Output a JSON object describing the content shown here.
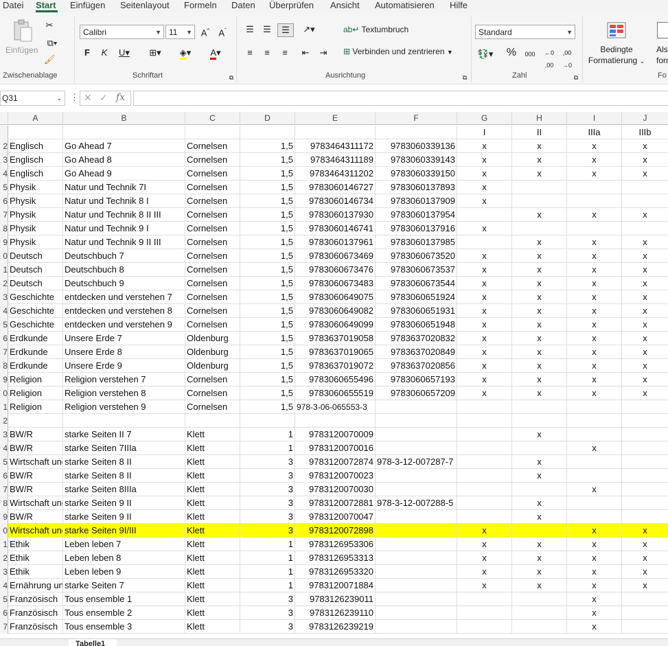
{
  "menu": [
    "Datei",
    "Start",
    "Einfügen",
    "Seitenlayout",
    "Formeln",
    "Daten",
    "Überprüfen",
    "Ansicht",
    "Automatisieren",
    "Hilfe"
  ],
  "ribbon": {
    "paste_label": "Einfügen",
    "clipboard_label": "Zwischenablage",
    "font_name": "Calibri",
    "font_size": "11",
    "font_label": "Schriftart",
    "wrap_label": "Textumbruch",
    "merge_label": "Verbinden und zentrieren",
    "alignment_label": "Ausrichtung",
    "number_format": "Standard",
    "number_label": "Zahl",
    "cond_format_label1": "Bedingte",
    "cond_format_label2": "Formatierung",
    "as_table_label1": "Als",
    "as_table_label2": "form",
    "styles_label": "Fo"
  },
  "formula_bar": {
    "name_box": "Q31",
    "content": ""
  },
  "columns": [
    "A",
    "B",
    "C",
    "D",
    "E",
    "F",
    "G",
    "H",
    "I",
    "J"
  ],
  "header_row": {
    "g": "I",
    "h": "II",
    "i": "IIIa",
    "j": "IIIb"
  },
  "rows": [
    {
      "n": "2",
      "a": "Englisch",
      "b": "Go Ahead 7",
      "c": "Cornelsen",
      "d": "1,5",
      "e": "9783464311172",
      "f": "9783060339136",
      "g": "x",
      "h": "x",
      "i": "x",
      "j": "x"
    },
    {
      "n": "3",
      "a": "Englisch",
      "b": "Go Ahead 8",
      "c": "Cornelsen",
      "d": "1,5",
      "e": "9783464311189",
      "f": "9783060339143",
      "g": "x",
      "h": "x",
      "i": "x",
      "j": "x"
    },
    {
      "n": "4",
      "a": "Englisch",
      "b": "Go Ahead 9",
      "c": "Cornelsen",
      "d": "1,5",
      "e": "9783464311202",
      "f": "9783060339150",
      "g": "x",
      "h": "x",
      "i": "x",
      "j": "x"
    },
    {
      "n": "5",
      "a": "Physik",
      "b": "Natur und Technik 7I",
      "c": "Cornelsen",
      "d": "1,5",
      "e": "9783060146727",
      "f": "9783060137893",
      "g": "x",
      "h": "",
      "i": "",
      "j": ""
    },
    {
      "n": "6",
      "a": "Physik",
      "b": "Natur und Technik 8 I",
      "c": "Cornelsen",
      "d": "1,5",
      "e": "9783060146734",
      "f": "9783060137909",
      "g": "x",
      "h": "",
      "i": "",
      "j": ""
    },
    {
      "n": "7",
      "a": "Physik",
      "b": "Natur und Technik 8 II III",
      "c": "Cornelsen",
      "d": "1,5",
      "e": "9783060137930",
      "f": "9783060137954",
      "g": "",
      "h": "x",
      "i": "x",
      "j": "x"
    },
    {
      "n": "8",
      "a": "Physik",
      "b": "Natur und Technik 9 I",
      "c": "Cornelsen",
      "d": "1,5",
      "e": "9783060146741",
      "f": "9783060137916",
      "g": "x",
      "h": "",
      "i": "",
      "j": ""
    },
    {
      "n": "9",
      "a": "Physik",
      "b": "Natur und Technik 9 II III",
      "c": "Cornelsen",
      "d": "1,5",
      "e": "9783060137961",
      "f": "9783060137985",
      "g": "",
      "h": "x",
      "i": "x",
      "j": "x"
    },
    {
      "n": "0",
      "a": "Deutsch",
      "b": "Deutschbuch 7",
      "c": "Cornelsen",
      "d": "1,5",
      "e": "9783060673469",
      "f": "9783060673520",
      "g": "x",
      "h": "x",
      "i": "x",
      "j": "x"
    },
    {
      "n": "1",
      "a": "Deutsch",
      "b": "Deutschbuch 8",
      "c": "Cornelsen",
      "d": "1,5",
      "e": "9783060673476",
      "f": "9783060673537",
      "g": "x",
      "h": "x",
      "i": "x",
      "j": "x"
    },
    {
      "n": "2",
      "a": "Deutsch",
      "b": "Deutschbuch 9",
      "c": "Cornelsen",
      "d": "1,5",
      "e": "9783060673483",
      "f": "9783060673544",
      "g": "x",
      "h": "x",
      "i": "x",
      "j": "x"
    },
    {
      "n": "3",
      "a": "Geschichte",
      "b": "entdecken und verstehen 7",
      "c": "Cornelsen",
      "d": "1,5",
      "e": "9783060649075",
      "f": "9783060651924",
      "g": "x",
      "h": "x",
      "i": "x",
      "j": "x"
    },
    {
      "n": "4",
      "a": "Geschichte",
      "b": "entdecken und verstehen 8",
      "c": "Cornelsen",
      "d": "1,5",
      "e": "9783060649082",
      "f": "9783060651931",
      "g": "x",
      "h": "x",
      "i": "x",
      "j": "x"
    },
    {
      "n": "5",
      "a": "Geschichte",
      "b": "entdecken und verstehen 9",
      "c": "Cornelsen",
      "d": "1,5",
      "e": "9783060649099",
      "f": "9783060651948",
      "g": "x",
      "h": "x",
      "i": "x",
      "j": "x"
    },
    {
      "n": "6",
      "a": "Erdkunde",
      "b": "Unsere Erde 7",
      "c": "Oldenburg",
      "d": "1,5",
      "e": "9783637019058",
      "f": "9783637020832",
      "g": "x",
      "h": "x",
      "i": "x",
      "j": "x"
    },
    {
      "n": "7",
      "a": "Erdkunde",
      "b": "Unsere Erde 8",
      "c": "Oldenburg",
      "d": "1,5",
      "e": "9783637019065",
      "f": "9783637020849",
      "g": "x",
      "h": "x",
      "i": "x",
      "j": "x"
    },
    {
      "n": "8",
      "a": "Erdkunde",
      "b": "Unsere Erde 9",
      "c": "Oldenburg",
      "d": "1,5",
      "e": "9783637019072",
      "f": "9783637020856",
      "g": "x",
      "h": "x",
      "i": "x",
      "j": "x"
    },
    {
      "n": "9",
      "a": "Religion",
      "b": "Religion verstehen 7",
      "c": "Cornelsen",
      "d": "1,5",
      "e": "9783060655496",
      "f": "9783060657193",
      "g": "x",
      "h": "x",
      "i": "x",
      "j": "x"
    },
    {
      "n": "0",
      "a": "Religion",
      "b": "Religion verstehen 8",
      "c": "Cornelsen",
      "d": "1,5",
      "e": "9783060655519",
      "f": "9783060657209",
      "g": "x",
      "h": "x",
      "i": "x",
      "j": "x"
    },
    {
      "n": "1",
      "a": "Religion",
      "b": "Religion verstehen 9",
      "c": "Cornelsen",
      "d": "1,5",
      "e": "978-3-06-065553-3",
      "f": "",
      "g": "",
      "h": "",
      "i": "",
      "j": ""
    },
    {
      "n": "2",
      "a": "",
      "b": "",
      "c": "",
      "d": "",
      "e": "",
      "f": "",
      "g": "",
      "h": "",
      "i": "",
      "j": ""
    },
    {
      "n": "3",
      "a": "BW/R",
      "b": "starke Seiten II 7",
      "c": "Klett",
      "d": "1",
      "e": "9783120070009",
      "f": "",
      "g": "",
      "h": "x",
      "i": "",
      "j": ""
    },
    {
      "n": "4",
      "a": "BW/R",
      "b": "starke Seiten 7IIIa",
      "c": "Klett",
      "d": "1",
      "e": "9783120070016",
      "f": "",
      "g": "",
      "h": "",
      "i": "x",
      "j": ""
    },
    {
      "n": "5",
      "a": "Wirtschaft und Beruf",
      "b": "starke Seiten 8 II",
      "c": "Klett",
      "d": "3",
      "e": "9783120072874",
      "f": "978-3-12-007287-7",
      "g": "",
      "h": "x",
      "i": "",
      "j": ""
    },
    {
      "n": "6",
      "a": "BW/R",
      "b": "starke Seiten 8 II",
      "c": "Klett",
      "d": "3",
      "e": "9783120070023",
      "f": "",
      "g": "",
      "h": "x",
      "i": "",
      "j": ""
    },
    {
      "n": "7",
      "a": "BW/R",
      "b": "starke Seiten 8IIIa",
      "c": "Klett",
      "d": "3",
      "e": "9783120070030",
      "f": "",
      "g": "",
      "h": "",
      "i": "x",
      "j": ""
    },
    {
      "n": "8",
      "a": "Wirtschaft und Beruf",
      "b": "starke Seiten 9 II",
      "c": "Klett",
      "d": "3",
      "e": "9783120072881",
      "f": "978-3-12-007288-5",
      "g": "",
      "h": "x",
      "i": "",
      "j": ""
    },
    {
      "n": "9",
      "a": "BW/R",
      "b": "starke Seiten 9 II",
      "c": "Klett",
      "d": "3",
      "e": "9783120070047",
      "f": "",
      "g": "",
      "h": "x",
      "i": "",
      "j": ""
    },
    {
      "n": "0",
      "a": "Wirtschaft und Beruf",
      "b": "starke Seiten 9I/III",
      "c": "Klett",
      "d": "3",
      "e": "9783120072898",
      "f": "",
      "g": "x",
      "h": "",
      "i": "x",
      "j": "x",
      "hl": true
    },
    {
      "n": "1",
      "a": "Ethik",
      "b": "Leben leben 7",
      "c": "Klett",
      "d": "1",
      "e": "9783126953306",
      "f": "",
      "g": "x",
      "h": "x",
      "i": "x",
      "j": "x"
    },
    {
      "n": "2",
      "a": "Ethik",
      "b": "Leben leben 8",
      "c": "Klett",
      "d": "1",
      "e": "9783126953313",
      "f": "",
      "g": "x",
      "h": "x",
      "i": "x",
      "j": "x"
    },
    {
      "n": "3",
      "a": "Ethik",
      "b": "Leben leben 9",
      "c": "Klett",
      "d": "1",
      "e": "9783126953320",
      "f": "",
      "g": "x",
      "h": "x",
      "i": "x",
      "j": "x"
    },
    {
      "n": "4",
      "a": "Ernährung und Soziales",
      "b": "starke Seiten 7",
      "c": "Klett",
      "d": "1",
      "e": "9783120071884",
      "f": "",
      "g": "x",
      "h": "x",
      "i": "x",
      "j": "x"
    },
    {
      "n": "5",
      "a": "Französisch",
      "b": "Tous ensemble 1",
      "c": "Klett",
      "d": "3",
      "e": "9783126239011",
      "f": "",
      "g": "",
      "h": "",
      "i": "x",
      "j": ""
    },
    {
      "n": "6",
      "a": "Französisch",
      "b": "Tous ensemble 2",
      "c": "Klett",
      "d": "3",
      "e": "9783126239110",
      "f": "",
      "g": "",
      "h": "",
      "i": "x",
      "j": ""
    },
    {
      "n": "7",
      "a": "Französisch",
      "b": "Tous ensemble 3",
      "c": "Klett",
      "d": "3",
      "e": "9783126239219",
      "f": "",
      "g": "",
      "h": "",
      "i": "x",
      "j": ""
    }
  ],
  "sheet_tab": "Tabelle1"
}
